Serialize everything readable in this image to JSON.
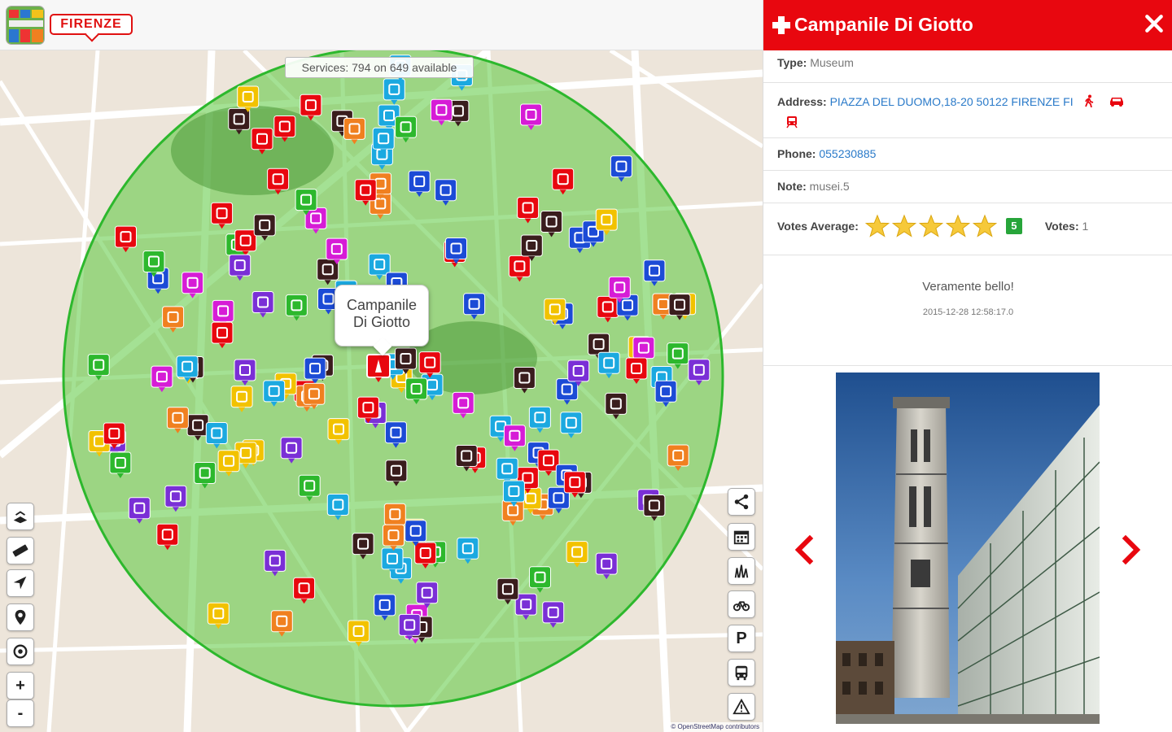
{
  "header": {
    "city_label": "FIRENZE"
  },
  "map": {
    "services_info": "Services: 794 on 649 available",
    "selected_marker_label_line1": "Campanile",
    "selected_marker_label_line2": "Di Giotto",
    "attribution": "© OpenStreetMap contributors",
    "radius_circle_color": "#2db82d",
    "marker_colors": [
      "#e8070f",
      "#d61cd6",
      "#3a1d1d",
      "#1c4bd6",
      "#1ba9e0",
      "#7a2fd6",
      "#2db82d",
      "#f2c200",
      "#f08020"
    ],
    "left_controls": [
      "layers-icon",
      "ruler-icon",
      "navigate-arrow-icon",
      "pin-icon",
      "locate-target-icon",
      "zoom-in-icon",
      "zoom-out-icon"
    ],
    "zoom_in_label": "+",
    "zoom_out_label": "-",
    "right_controls": [
      "share-icon",
      "calendar-icon",
      "grass-icon",
      "bicycle-icon",
      "parking-icon",
      "bus-icon",
      "warning-icon"
    ],
    "parking_label": "P"
  },
  "panel": {
    "title": "Campanile Di Giotto",
    "type_label": "Type:",
    "type_value": "Museum",
    "address_label": "Address:",
    "address_value": "PIAZZA DEL DUOMO,18-20 50122 FIRENZE FI",
    "phone_label": "Phone:",
    "phone_value": "055230885",
    "note_label": "Note:",
    "note_value": "musei.5",
    "votes_average_label": "Votes Average:",
    "rating": 5,
    "score": "5",
    "votes_label": "Votes:",
    "votes_value": "1",
    "review_text": "Veramente bello!",
    "review_date": "2015-12-28 12:58:17.0",
    "accent_color": "#e8070f"
  }
}
